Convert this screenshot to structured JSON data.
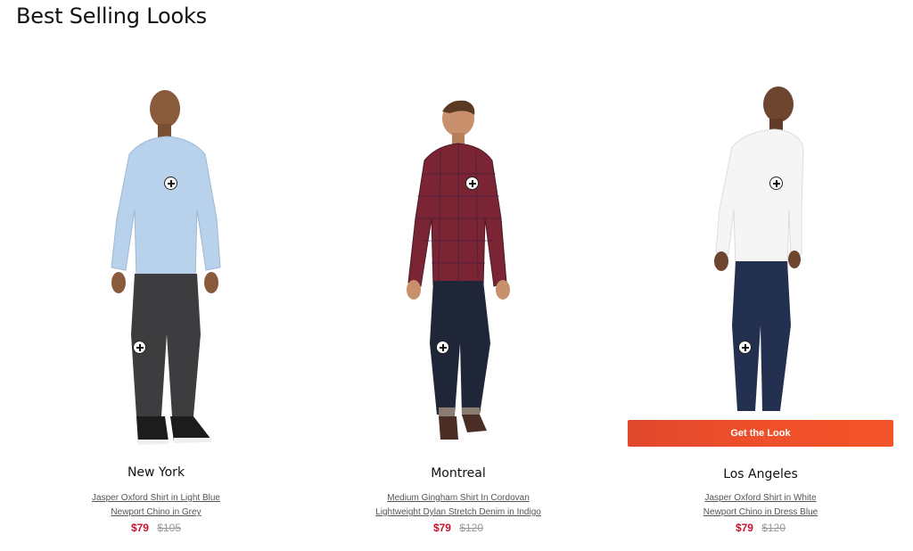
{
  "page": {
    "title": "Best Selling Looks"
  },
  "colors": {
    "accent": "#f0502a",
    "sale_price": "#c8102e",
    "original_price": "#999999",
    "link": "#555555"
  },
  "looks": [
    {
      "name": "New York",
      "items": [
        "Jasper Oxford Shirt in Light Blue",
        "Newport Chino in Grey"
      ],
      "sale_price": "$79",
      "original_price": "$105",
      "shirt_color": "#b9d2ec",
      "pants_color": "#3d3d3f",
      "shoe_color": "#1c1c1c",
      "show_button": false
    },
    {
      "name": "Montreal",
      "items": [
        "Medium Gingham Shirt In Cordovan",
        "Lightweight Dylan Stretch Denim in Indigo"
      ],
      "sale_price": "$79",
      "original_price": "$120",
      "shirt_color": "#7a2434",
      "pants_color": "#1f2637",
      "shoe_color": "#4a2e26",
      "show_button": false
    },
    {
      "name": "Los Angeles",
      "items": [
        "Jasper Oxford Shirt in White",
        "Newport Chino in Dress Blue"
      ],
      "sale_price": "$79",
      "original_price": "$120",
      "shirt_color": "#f5f5f5",
      "pants_color": "#24304f",
      "shoe_color": "#e8e8e8",
      "show_button": true,
      "button_label": "Get the Look"
    }
  ]
}
